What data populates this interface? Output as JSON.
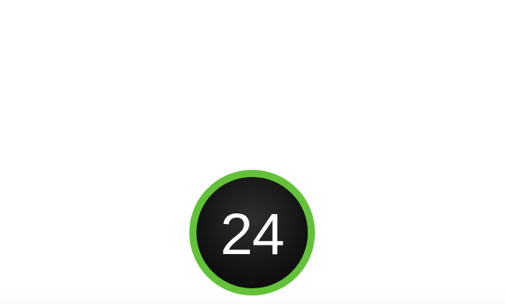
{
  "badge": {
    "value": "24",
    "ring_color": "#64c23a",
    "fill_color": "#111111",
    "text_color": "#ffffff"
  }
}
